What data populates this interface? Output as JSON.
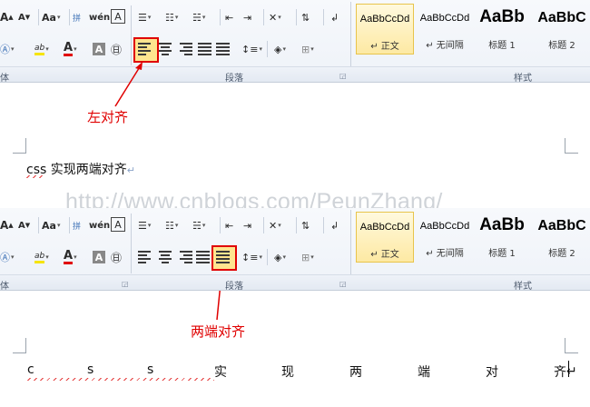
{
  "ribbon": {
    "font_buttons": {
      "grow": "A",
      "shrink": "A",
      "case": "Aa",
      "phonetic": "wén",
      "char_border": "A",
      "char_shade": "A",
      "enclose": "字",
      "highlight_label": "ab",
      "font_color_label": "A"
    },
    "group_labels": {
      "font": "体",
      "paragraph": "段落",
      "styles": "样式"
    },
    "styles_gallery": [
      {
        "sample": "AaBbCcDd",
        "name": "↵ 正文",
        "active": true
      },
      {
        "sample": "AaBbCcDd",
        "name": "↵ 无间隔",
        "active": false
      },
      {
        "sample": "AaBb",
        "name": "标题 1",
        "active": false
      },
      {
        "sample": "AaBbC",
        "name": "标题 2",
        "active": false
      }
    ],
    "colors": {
      "highlight": "#f6e400",
      "font_color": "#e00000"
    }
  },
  "section1": {
    "annotation": "左对齐",
    "doc_word": "css",
    "doc_rest": " 实现两端对齐",
    "para_mark": "↵"
  },
  "watermark": "http://www.cnblogs.com/PeunZhang/",
  "section2": {
    "annotation": "两端对齐",
    "justified_chars": [
      "c",
      "s",
      "s",
      "实",
      "现",
      "两",
      "端",
      "对",
      "齐"
    ],
    "para_mark": "↵"
  }
}
